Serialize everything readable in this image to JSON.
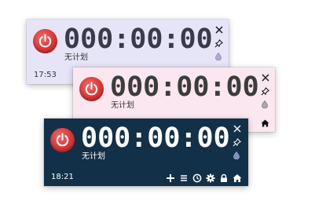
{
  "windows": [
    {
      "theme": "lavender",
      "background": "#e6e4f7",
      "timer": "000:00:00",
      "plan": "无计划",
      "clock_time": "17:53"
    },
    {
      "theme": "pink",
      "background": "#fbe7f0",
      "timer": "000:00:00",
      "plan": "无计划"
    },
    {
      "theme": "dark",
      "background": "#123047",
      "timer": "000:00:00",
      "plan": "无计划",
      "clock_time": "18:21",
      "toolbar_icons": [
        "add-icon",
        "list-icon",
        "clock-icon",
        "settings-icon",
        "lock-icon",
        "home-icon"
      ]
    }
  ],
  "icons": {
    "power": "power-icon",
    "close": "close-icon",
    "pin": "pin-icon",
    "drop": "color-drop-icon",
    "home": "home-icon"
  },
  "colors": {
    "lavender_text": "#3a3a4a",
    "dark_text": "#ffffff",
    "power_red": "#d93636"
  }
}
